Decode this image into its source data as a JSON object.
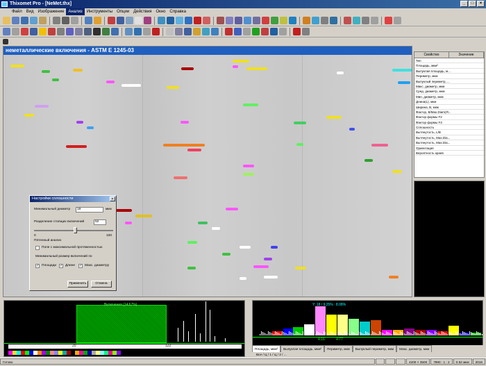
{
  "window": {
    "title": "Thixomet Pro - [NeMet.thx]"
  },
  "menu": {
    "items": [
      "Файл",
      "Вид",
      "Изображение",
      "Анализ",
      "Инструменты",
      "Опции",
      "Действия",
      "Окно",
      "Справка"
    ],
    "active_index": 3
  },
  "image": {
    "title": "неметаллические включения - ASTM E 1245-03"
  },
  "properties": {
    "header_property": "Свойство",
    "header_value": "Значение",
    "rows": [
      "Тип",
      "Площадь, мкм²",
      "Выпуклая площадь, м...",
      "Периметр, мкм",
      "Выпуклый периметр, ...",
      "Макс. диаметр, мкм",
      "Сред. диаметр, мкм",
      "Мин. диаметр, мкм",
      "Длина(L), мкм",
      "Ширина, B, мкм",
      "Фактор, B/Max.Diam(Я...",
      "Фактор формы F2",
      "Фактор формы F3",
      "Сплошность",
      "Вытянутость, L/B",
      "Вытянутость, Max.Dia...",
      "Вытянутость, Max.Dia...",
      "Ориентация",
      "Вероятность краев"
    ]
  },
  "dialog": {
    "title": "Настройки сплошности",
    "min_diameter_label": "Минимальный диаметр",
    "min_diameter_value": "18",
    "min_diameter_unit": "мкм",
    "separation_label": "Разделение стоящих включений",
    "separation_value": "52",
    "slider_min": "0",
    "slider_max": "100",
    "slider_value": 0.52,
    "group_label": "Пятенный анализ",
    "option_orient": "Поле с максимальной протяженностью",
    "min_size_label": "Минимальный размер включений по",
    "check_area": "Площади",
    "check_length": "Длине",
    "check_maxdiam": "Макс. диаметру",
    "apply_label": "Применить",
    "cancel_label": "Отмена"
  },
  "histogram_left": {
    "overlay_label": "Включения (14.67%)",
    "x_left": "20",
    "x_right": "122"
  },
  "histogram_right": {
    "overlay_label": "Y: 18 / 9.25% : 8.08%",
    "x_left": "4.16",
    "x_right": "4.77",
    "tabs": [
      "Площадь, мкм²",
      "Выпуклая площадь, мкм²",
      "Периметр, мкм",
      "Выпуклый периметр, мкм",
      "Макс. диаметр, мкм"
    ],
    "subtab": "Все / Ц / 1 / Ц / 2 / ..."
  },
  "status": {
    "items": [
      "Готово",
      "",
      "",
      "",
      "4200 × 3500",
      "7890 : 1 : 2",
      "0.52 мкм",
      "2016"
    ]
  },
  "colors": {
    "accent": "#1f5fbf",
    "hist_green": "#00c000"
  }
}
